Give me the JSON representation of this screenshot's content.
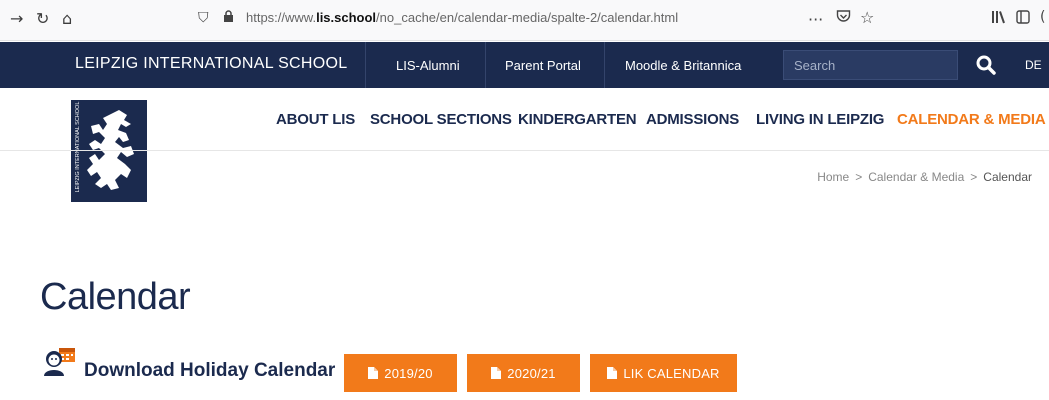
{
  "browser": {
    "url_prefix": "https://www.",
    "url_domain": "lis.school",
    "url_path": "/no_cache/en/calendar-media/spalte-2/calendar.html",
    "more_icon": "ellipsis-icon",
    "pocket_icon": "pocket-icon",
    "bookmark_icon": "star-icon"
  },
  "topbar": {
    "brand": "LEIPZIG INTERNATIONAL SCHOOL",
    "links": [
      "LIS-Alumni",
      "Parent Portal",
      "Moodle & Britannica"
    ],
    "search_placeholder": "Search",
    "lang": "DE"
  },
  "logo": {
    "vertical_text": "LEIPZIG INTERNATIONAL SCHOOL"
  },
  "nav": {
    "items": [
      "ABOUT LIS",
      "SCHOOL SECTIONS",
      "KINDERGARTEN",
      "ADMISSIONS",
      "LIVING IN LEIPZIG",
      "CALENDAR & MEDIA"
    ],
    "active_index": 5
  },
  "breadcrumb": [
    "Home",
    "Calendar & Media",
    "Calendar"
  ],
  "page": {
    "title": "Calendar",
    "download_label": "Download Holiday Calendar",
    "buttons": [
      "2019/20",
      "2020/21",
      "LIK CALENDAR"
    ]
  },
  "colors": {
    "navy": "#1b2a4e",
    "orange": "#f27a1a"
  }
}
